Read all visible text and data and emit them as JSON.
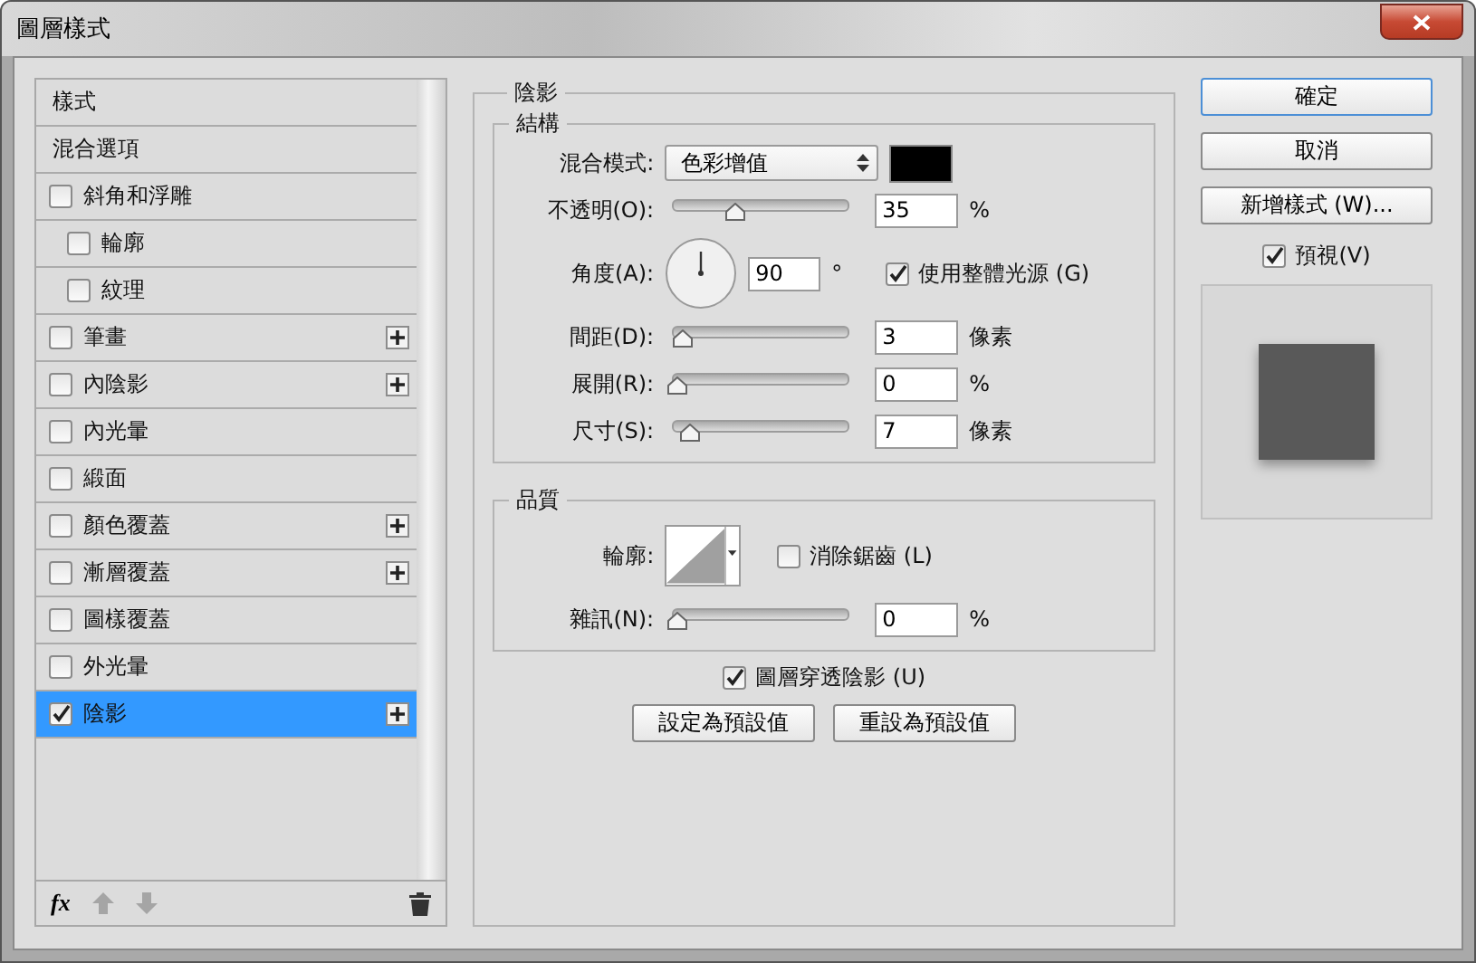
{
  "window": {
    "title": "圖層樣式"
  },
  "styles_list": {
    "items": [
      {
        "label": "樣式",
        "kind": "plain",
        "selected": false
      },
      {
        "label": "混合選項",
        "kind": "plain",
        "selected": false
      },
      {
        "label": "斜角和浮雕",
        "kind": "check",
        "checked": false,
        "selected": false,
        "add_button": false,
        "children": [
          {
            "label": "輪廓",
            "kind": "check",
            "checked": false,
            "selected": false,
            "add_button": false
          },
          {
            "label": "紋理",
            "kind": "check",
            "checked": false,
            "selected": false,
            "add_button": false
          }
        ]
      },
      {
        "label": "筆畫",
        "kind": "check",
        "checked": false,
        "selected": false,
        "add_button": true
      },
      {
        "label": "內陰影",
        "kind": "check",
        "checked": false,
        "selected": false,
        "add_button": true
      },
      {
        "label": "內光暈",
        "kind": "check",
        "checked": false,
        "selected": false,
        "add_button": false
      },
      {
        "label": "緞面",
        "kind": "check",
        "checked": false,
        "selected": false,
        "add_button": false
      },
      {
        "label": "顏色覆蓋",
        "kind": "check",
        "checked": false,
        "selected": false,
        "add_button": true
      },
      {
        "label": "漸層覆蓋",
        "kind": "check",
        "checked": false,
        "selected": false,
        "add_button": true
      },
      {
        "label": "圖樣覆蓋",
        "kind": "check",
        "checked": false,
        "selected": false,
        "add_button": false
      },
      {
        "label": "外光暈",
        "kind": "check",
        "checked": false,
        "selected": false,
        "add_button": false
      },
      {
        "label": "陰影",
        "kind": "check",
        "checked": true,
        "selected": true,
        "add_button": true
      }
    ],
    "footer": {
      "fx": "fx"
    }
  },
  "panel": {
    "title": "陰影",
    "structure": {
      "title": "結構",
      "rows": [
        {
          "kind": "select",
          "label": "混合模式:",
          "value": "色彩增值",
          "color": "#000000"
        },
        {
          "kind": "slider",
          "label": "不透明(O):",
          "level": 0.35,
          "value": "35",
          "unit": "%"
        },
        {
          "kind": "angle",
          "label": "角度(A):",
          "value": "90",
          "unit": "°",
          "check_label": "使用整體光源 (G)",
          "checked": true
        },
        {
          "kind": "slider",
          "label": "間距(D):",
          "level": 0.03,
          "value": "3",
          "unit": "像素"
        },
        {
          "kind": "slider",
          "label": "展開(R):",
          "level": 0,
          "value": "0",
          "unit": "%"
        },
        {
          "kind": "slider",
          "label": "尺寸(S):",
          "level": 0.07,
          "value": "7",
          "unit": "像素"
        }
      ]
    },
    "quality": {
      "title": "品質",
      "rows": [
        {
          "kind": "contour",
          "label": "輪廓:",
          "check_label": "消除鋸齒 (L)",
          "checked": false
        },
        {
          "kind": "slider",
          "label": "雜訊(N):",
          "level": 0,
          "value": "0",
          "unit": "%"
        }
      ]
    },
    "knockout": {
      "label": "圖層穿透陰影 (U)",
      "checked": true
    },
    "buttons": [
      "設定為預設值",
      "重設為預設值"
    ]
  },
  "actions": {
    "buttons": [
      {
        "label": "確定",
        "default": true
      },
      {
        "label": "取消",
        "default": false
      },
      {
        "label": "新增樣式 (W)...",
        "default": false
      }
    ],
    "preview": {
      "label": "預視(V)",
      "checked": true
    }
  }
}
